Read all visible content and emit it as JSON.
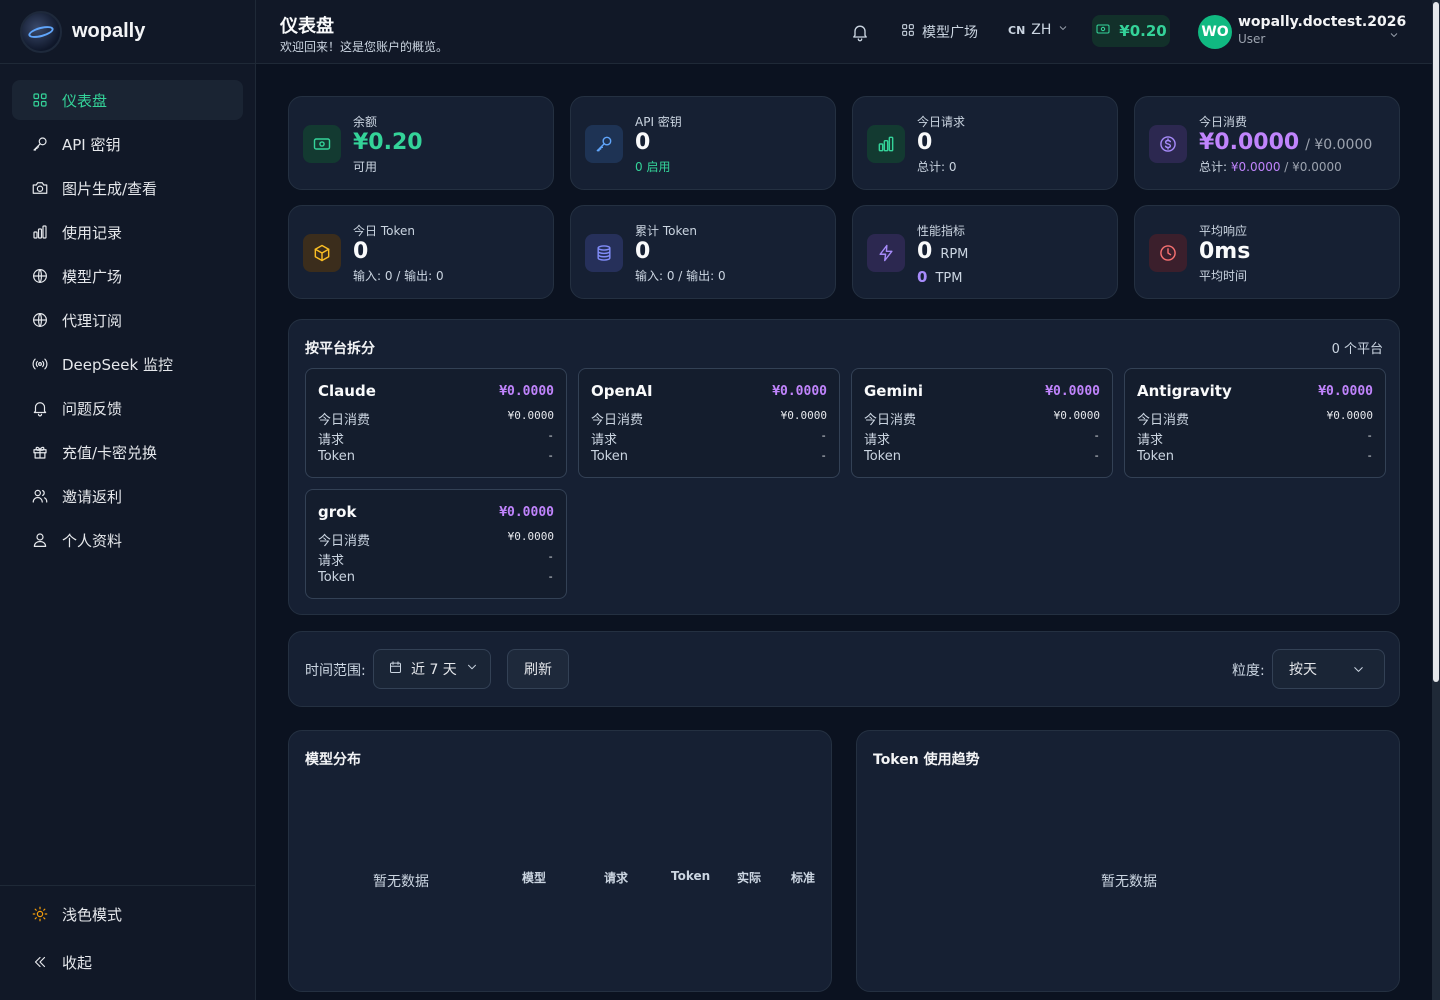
{
  "brand": {
    "name": "wopally"
  },
  "sidebar": {
    "items": [
      {
        "label": "仪表盘",
        "icon": "dashboard-icon"
      },
      {
        "label": "API 密钥",
        "icon": "key-icon"
      },
      {
        "label": "图片生成/查看",
        "icon": "camera-icon"
      },
      {
        "label": "使用记录",
        "icon": "bar-chart-icon"
      },
      {
        "label": "模型广场",
        "icon": "globe-icon"
      },
      {
        "label": "代理订阅",
        "icon": "globe-icon"
      },
      {
        "label": "DeepSeek 监控",
        "icon": "broadcast-icon"
      },
      {
        "label": "问题反馈",
        "icon": "bell-icon"
      },
      {
        "label": "充值/卡密兑换",
        "icon": "gift-icon"
      },
      {
        "label": "邀请返利",
        "icon": "users-icon"
      },
      {
        "label": "个人资料",
        "icon": "user-icon"
      }
    ],
    "bottom": {
      "theme_label": "浅色模式",
      "collapse_label": "收起"
    }
  },
  "header": {
    "title": "仪表盘",
    "subtitle": "欢迎回来！这是您账户的概览。",
    "model_square": "模型广场",
    "lang_code": "CN",
    "lang": "ZH",
    "balance": "¥0.20",
    "avatar": "WO",
    "username": "wopally.doctest.2026",
    "role": "User"
  },
  "stats": [
    {
      "label": "余额",
      "value": "¥0.20",
      "sub": "可用"
    },
    {
      "label": "API 密钥",
      "value": "0",
      "sub": "0 启用"
    },
    {
      "label": "今日请求",
      "value": "0",
      "sub": "总计: 0"
    },
    {
      "label": "今日消费",
      "value": "¥0.0000",
      "value_extra": "/ ¥0.0000",
      "sub_prefix": "总计: ",
      "sub_value": "¥0.0000",
      "sub_suffix": " / ¥0.0000"
    },
    {
      "label": "今日 Token",
      "value": "0",
      "sub": "输入: 0 / 输出: 0"
    },
    {
      "label": "累计 Token",
      "value": "0",
      "sub": "输入: 0 / 输出: 0"
    },
    {
      "label": "性能指标",
      "value": "0",
      "unit": "RPM",
      "value2": "0",
      "unit2": "TPM"
    },
    {
      "label": "平均响应",
      "value": "0ms",
      "sub": "平均时间"
    }
  ],
  "platforms": {
    "title": "按平台拆分",
    "count": "0 个平台",
    "row_labels": [
      "今日消费",
      "请求",
      "Token"
    ],
    "items": [
      {
        "name": "Claude",
        "cost": "¥0.0000",
        "today": "¥0.0000",
        "requests": "-",
        "tokens": "-"
      },
      {
        "name": "OpenAI",
        "cost": "¥0.0000",
        "today": "¥0.0000",
        "requests": "-",
        "tokens": "-"
      },
      {
        "name": "Gemini",
        "cost": "¥0.0000",
        "today": "¥0.0000",
        "requests": "-",
        "tokens": "-"
      },
      {
        "name": "Antigravity",
        "cost": "¥0.0000",
        "today": "¥0.0000",
        "requests": "-",
        "tokens": "-"
      },
      {
        "name": "grok",
        "cost": "¥0.0000",
        "today": "¥0.0000",
        "requests": "-",
        "tokens": "-"
      }
    ]
  },
  "filters": {
    "range_label": "时间范围:",
    "range_value": "近 7 天",
    "refresh": "刷新",
    "granularity_label": "粒度:",
    "granularity_value": "按天"
  },
  "model_dist": {
    "title": "模型分布",
    "empty": "暂无数据",
    "columns": [
      "模型",
      "请求",
      "Token",
      "实际",
      "标准"
    ]
  },
  "token_trend": {
    "title": "Token 使用趋势",
    "empty": "暂无数据"
  },
  "colors": {
    "accent": "#34d399",
    "purple": "#c084fc",
    "bg": "#0b1220",
    "card": "#162033"
  }
}
